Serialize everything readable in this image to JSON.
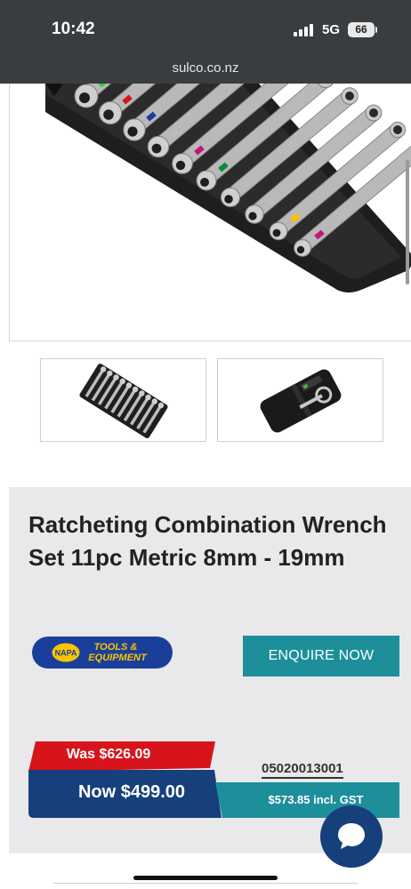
{
  "status_bar": {
    "time": "10:42",
    "network": "5G",
    "battery": "66",
    "icons": [
      "signal-icon",
      "battery-icon"
    ]
  },
  "browser": {
    "url": "sulco.co.nz"
  },
  "gallery": {
    "main_image": "wrench-set-open-roll",
    "thumbnails": [
      "wrench-set-open-roll",
      "wrench-set-rolled-pouch"
    ]
  },
  "product": {
    "title": "Ratcheting Combination Wrench Set 11pc Metric 8mm - 19mm",
    "brand_logo": {
      "brand": "NAPA",
      "tagline_line1": "TOOLS &",
      "tagline_line2": "EQUIPMENT"
    },
    "enquire_label": "ENQUIRE NOW",
    "was_price": "Was $626.09",
    "now_price": "Now $499.00",
    "gst_price": "$573.85 incl. GST",
    "sku": "05020013001"
  },
  "colors": {
    "status_bg": "#3a3d40",
    "teal": "#1d8f9b",
    "red": "#d7141c",
    "navy": "#16407c",
    "panel_bg": "#e9e9eb",
    "napa_yellow": "#f7c500",
    "napa_blue": "#1a3f9a"
  },
  "chat": {
    "icon": "chat-bubble-icon"
  }
}
